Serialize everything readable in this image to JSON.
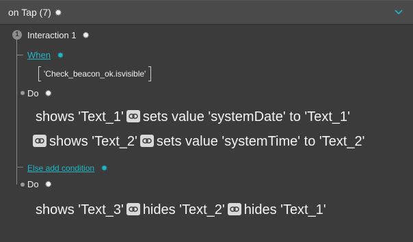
{
  "header": {
    "title": "on Tap (7)",
    "gear_icon": "gear-icon",
    "collapse_icon": "chevron-down-icon"
  },
  "interaction": {
    "number": "1",
    "label": "Interaction 1"
  },
  "when": {
    "label": "When",
    "condition": "'Check_beacon_ok.isvisible'"
  },
  "do_1": {
    "label": "Do",
    "row1": {
      "a1": "shows 'Text_1'",
      "a2": "sets value 'systemDate' to 'Text_1'"
    },
    "row2": {
      "a1": "shows 'Text_2'",
      "a2": "sets value 'systemTime' to 'Text_2'"
    }
  },
  "else": {
    "label": "Else add condition"
  },
  "do_2": {
    "label": "Do",
    "row1": {
      "a1": "shows 'Text_3'",
      "a2": "hides 'Text_2'",
      "a3": "hides 'Text_1'"
    }
  },
  "colors": {
    "accent": "#1fb5c5",
    "panel_bg": "#3b3b3b",
    "header_bg": "#4a4a4a",
    "chip_bg": "#d9d9d9"
  }
}
